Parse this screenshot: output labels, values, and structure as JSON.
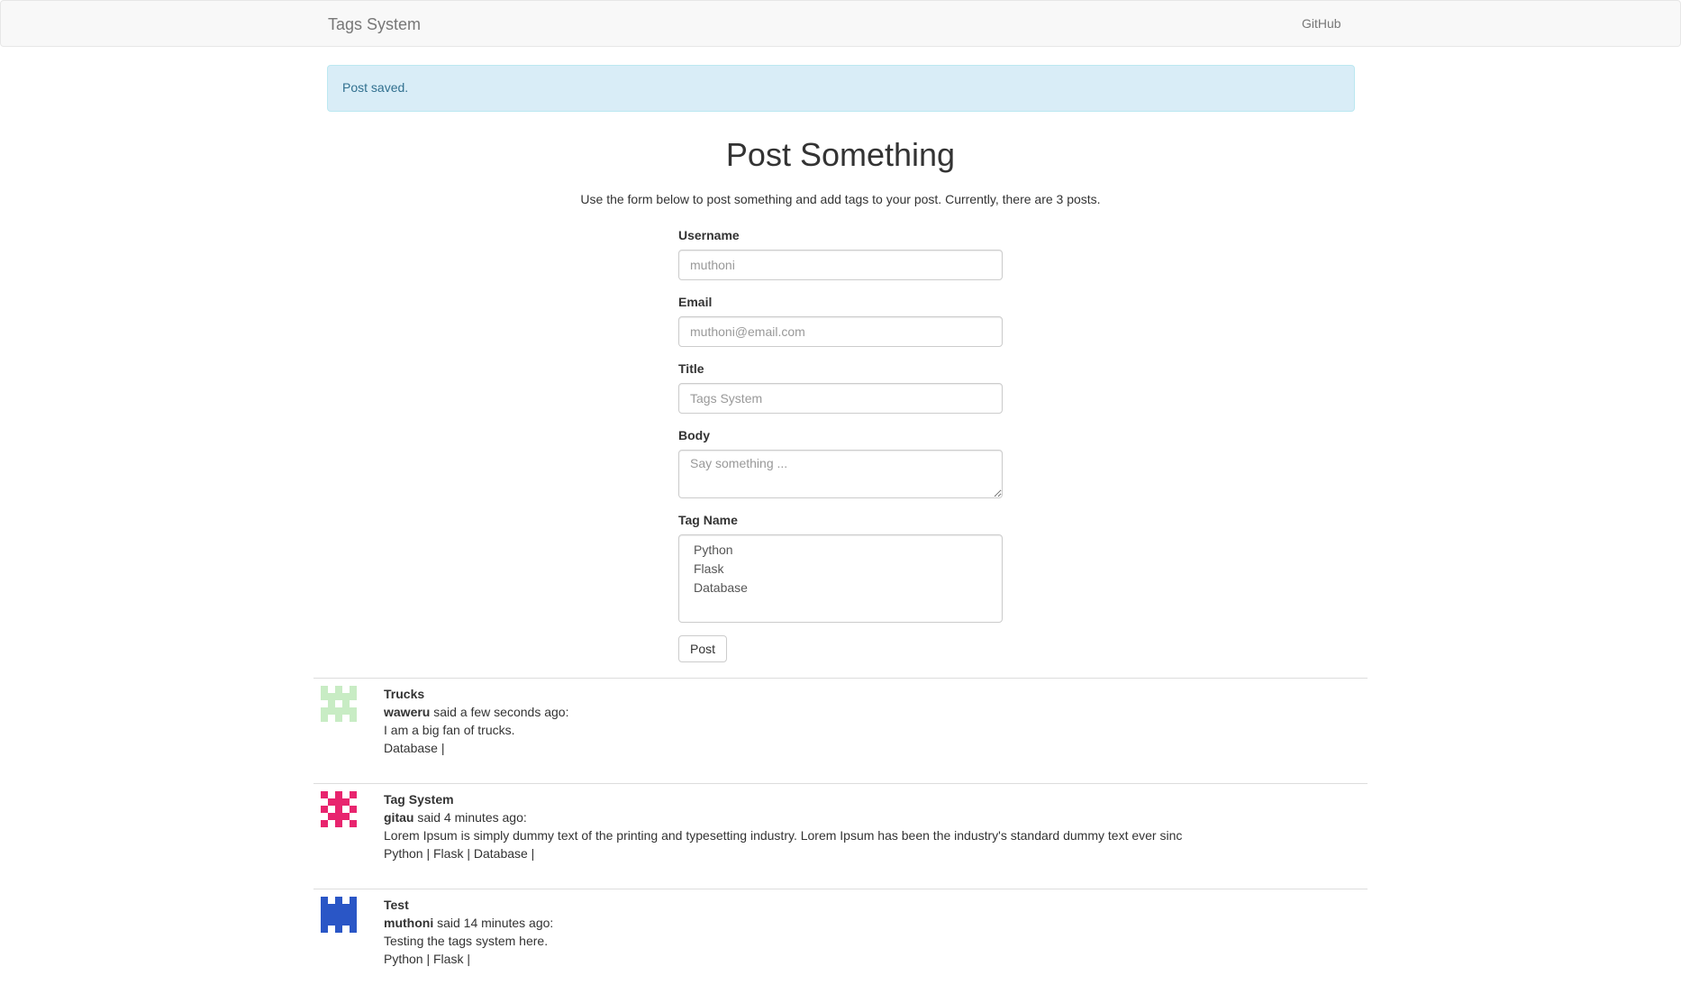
{
  "navbar": {
    "brand": "Tags System",
    "github": "GitHub"
  },
  "alert": {
    "message": "Post saved."
  },
  "page": {
    "title": "Post Something",
    "description": "Use the form below to post something and add tags to your post. Currently, there are 3 posts."
  },
  "form": {
    "username": {
      "label": "Username",
      "placeholder": "muthoni"
    },
    "email": {
      "label": "Email",
      "placeholder": "muthoni@email.com"
    },
    "title": {
      "label": "Title",
      "placeholder": "Tags System"
    },
    "body": {
      "label": "Body",
      "placeholder": "Say something ..."
    },
    "tags": {
      "label": "Tag Name",
      "options": [
        "Python",
        "Flask",
        "Database"
      ]
    },
    "submit_label": "Post"
  },
  "posts": [
    {
      "title": "Trucks",
      "author": "waweru",
      "time": " said a few seconds ago:",
      "body": "I am a big fan of trucks.",
      "tags": "Database |",
      "avatar_color": "#c8ecc4",
      "avatar_icon": "identicon-avatar"
    },
    {
      "title": "Tag System",
      "author": "gitau",
      "time": " said 4 minutes ago:",
      "body": "Lorem Ipsum is simply dummy text of the printing and typesetting industry. Lorem Ipsum has been the industry's standard dummy text ever sinc",
      "tags": "Python | Flask | Database |",
      "avatar_color": "#e8246e",
      "avatar_icon": "identicon-avatar"
    },
    {
      "title": "Test",
      "author": "muthoni",
      "time": " said 14 minutes ago:",
      "body": "Testing the tags system here.",
      "tags": "Python | Flask |",
      "avatar_color": "#2a56c6",
      "avatar_icon": "identicon-avatar"
    }
  ]
}
